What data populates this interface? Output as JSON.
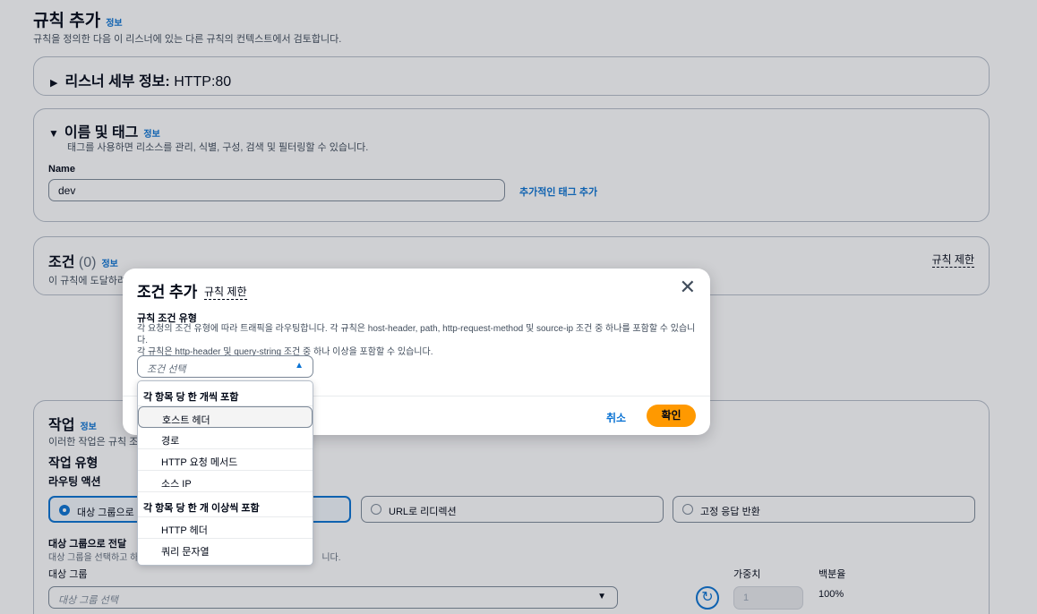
{
  "page": {
    "title": "규칙 추가",
    "info": "정보",
    "subtitle": "규칙을 정의한 다음 이 리스너에 있는 다른 규칙의 컨텍스트에서 검토합니다."
  },
  "listener": {
    "title_bold": "리스너 세부 정보:",
    "title_value": "HTTP:80"
  },
  "name_tags": {
    "title": "이름 및 태그",
    "info": "정보",
    "description": "태그를 사용하면 리소스를 관리, 식별, 구성, 검색 및 필터링할 수 있습니다.",
    "name_label": "Name",
    "name_value": "dev",
    "add_tag_link": "추가적인 태그 추가"
  },
  "conditions": {
    "title": "조건",
    "count": "(0)",
    "info": "정보",
    "description": "이 규칙에 도달하려",
    "limit_link": "규칙 제한"
  },
  "actions": {
    "title": "작업",
    "info": "정보",
    "description": "이러한 작업은 규칙 조",
    "type_heading": "작업 유형",
    "routing_heading": "라우팅 액션",
    "radio_target": "대상 그룹으로",
    "radio_redirect": "URL로 리디렉션",
    "radio_fixed": "고정 응답 반환",
    "forward_label": "대상 그룹으로 전달",
    "forward_desc_left": "대상 그룹을 선택하고 하",
    "forward_desc_right": "니다.",
    "target_group_label": "대상 그룹",
    "target_group_placeholder": "대상 그룹 선택",
    "weight_label": "가중치",
    "weight_value": "1",
    "percent_label": "백분율",
    "percent_value": "100%"
  },
  "modal": {
    "title": "조건 추가",
    "limit_link": "규칙 제한",
    "field_label": "규칙 조건 유형",
    "description_line1": "각 요청의 조건 유형에 따라 트래픽을 라우팅합니다. 각 규칙은 host-header, path, http-request-method 및 source-ip 조건 중 하나를 포함할 수 있습니다.",
    "description_line2": "각 규칙은 http-header 및 query-string 조건 중 하나 이상을 포함할 수 있습니다.",
    "select_placeholder": "조건 선택",
    "cancel_label": "취소",
    "confirm_label": "확인"
  },
  "dropdown": {
    "group1_label": "각 항목 당 한 개씩 포함",
    "group1_items": [
      "호스트 헤더",
      "경로",
      "HTTP 요청 메서드",
      "소스 IP"
    ],
    "group2_label": "각 항목 당 한 개 이상씩 포함",
    "group2_items": [
      "HTTP 헤더",
      "쿼리 문자열"
    ]
  },
  "colors": {
    "link": "#0972d3",
    "primary_button": "#ff9900",
    "border": "#7d8998"
  }
}
